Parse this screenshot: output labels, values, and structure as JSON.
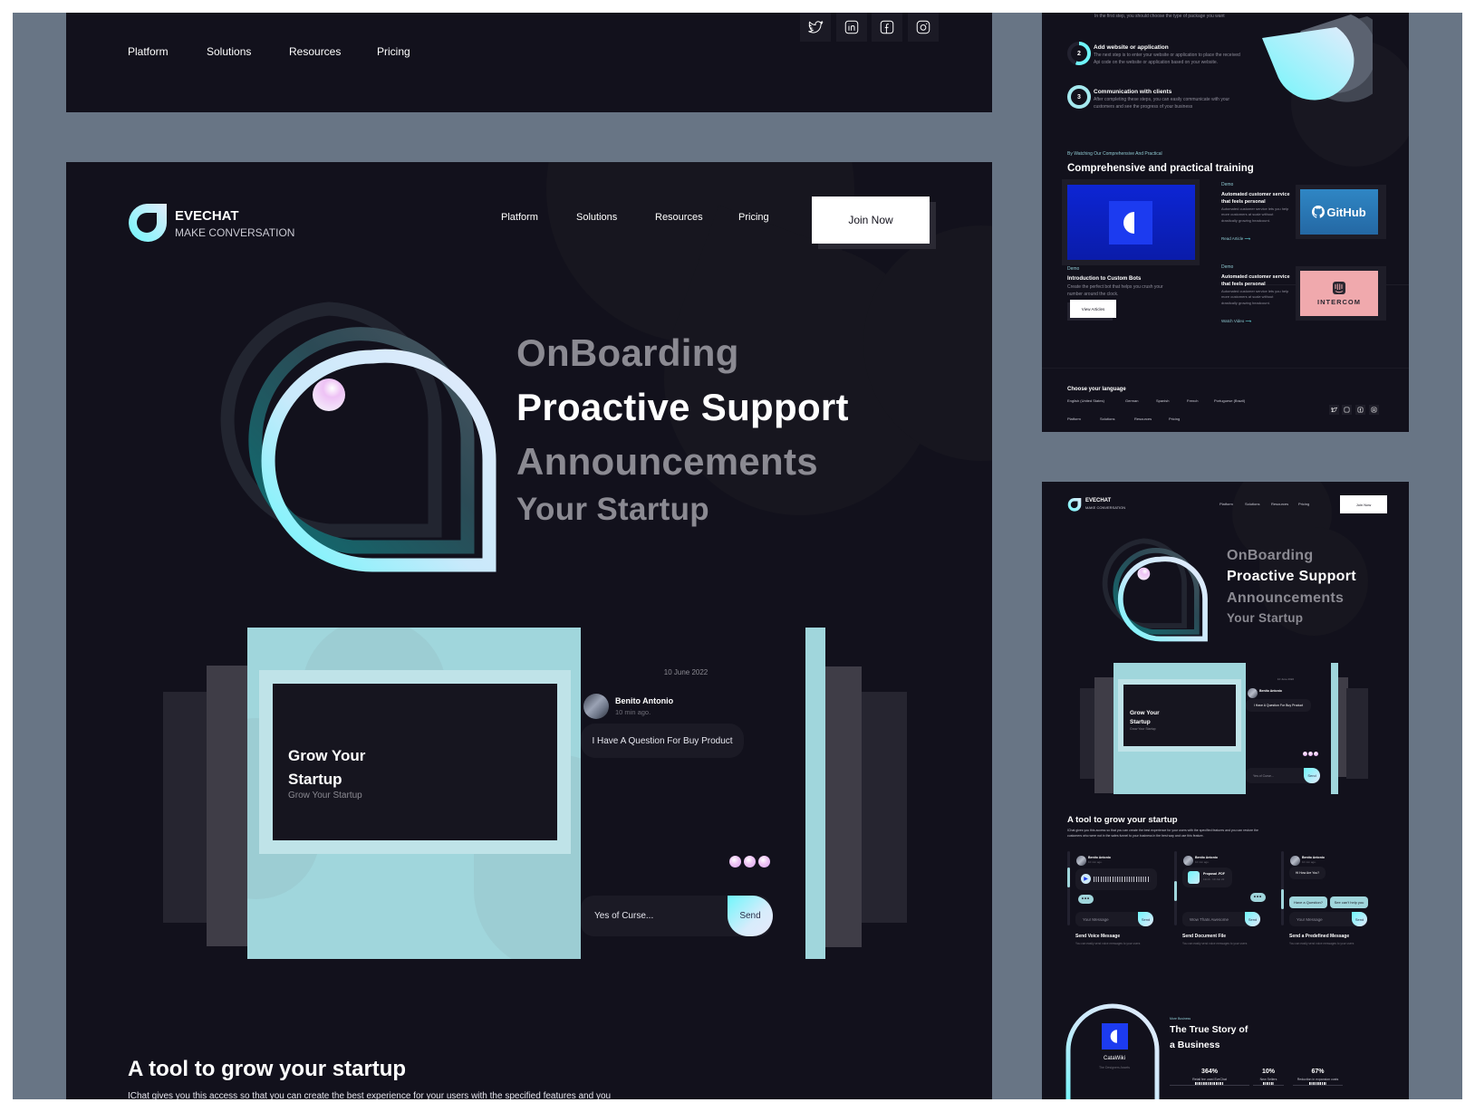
{
  "footer_top": {
    "nav": [
      "Platform",
      "Solutions",
      "Resources",
      "Pricing"
    ],
    "social": [
      "twitter-icon",
      "linkedin-icon",
      "facebook-icon",
      "instagram-icon"
    ]
  },
  "header": {
    "brand": "EVECHAT",
    "tagline": "MAKE CONVERSATION",
    "nav": [
      "Platform",
      "Solutions",
      "Resources",
      "Pricing"
    ],
    "cta": "Join Now"
  },
  "hero": {
    "lines": [
      "OnBoarding",
      "Proactive Support",
      "Announcements",
      "Your Startup"
    ],
    "active_index": 1
  },
  "showcase": {
    "card_title_1": "Grow Your",
    "card_title_2": "Startup",
    "card_subtitle": "Grow Your Startup",
    "chat": {
      "date": "10 June 2022",
      "user_name": "Benito Antonio",
      "time_ago": "10 min ago.",
      "message": "I Have A Question For Buy Product",
      "input_value": "Yes of Curse...",
      "send_label": "Send"
    }
  },
  "tool_section": {
    "title": "A tool to grow your startup",
    "description": "IChat gives you this access so that you can create the best experience for your users with the specified features and you",
    "description_full": "IChat gives you this access so that you can create the best experience for your users with the specified features and you can restore the customers who were not in the sales funnel to your business in the best way and use this feature."
  },
  "steps_panel": {
    "step1_desc": "In the first step, you should choose the type of package you want",
    "steps": [
      {
        "number": "2",
        "title": "Add website or application",
        "desc": "The next step is to enter your website or application to place the received Api code on the website or application based on your website."
      },
      {
        "number": "3",
        "title": "Communication with clients",
        "desc": "After completing these steps, you can easily communicate with your customers and see the progress of your business"
      }
    ],
    "training_kicker": "By Watching Our Comprehensive And Practical",
    "training_title": "Comprehensive and practical training",
    "featured": {
      "label": "Demo",
      "title": "Introduction to Custom Bots",
      "desc": "Create the perfect bot that helps you crush your number around the clock.",
      "button": "View Articles"
    },
    "articles": [
      {
        "label": "Demo",
        "title": "Automated customer service that feels personal",
        "desc": "Automated customer service lets you help more customers at scale without drastically growing headcount.",
        "link": "Read Article",
        "brand": "GitHub",
        "brand_color": "#2f86c4"
      },
      {
        "label": "Demo",
        "title": "Automated customer service that feels personal",
        "desc": "Automated customer service lets you help more customers at scale without drastically growing headcount.",
        "link": "Watch Video",
        "brand": "INTERCOM",
        "brand_color": "#f0a9ad"
      }
    ],
    "language_title": "Choose your language",
    "languages": [
      "English (United States)",
      "German",
      "Spanish",
      "French",
      "Portuguese (Brazil)"
    ],
    "footer_nav": [
      "Platform",
      "Solutions",
      "Resources",
      "Pricing"
    ]
  },
  "mobile_preview": {
    "brand": "EVECHAT",
    "tagline": "MAKE CONVERSATION",
    "nav": [
      "Platform",
      "Solutions",
      "Resources",
      "Pricing"
    ],
    "cta": "Join Now",
    "hero_lines": [
      "OnBoarding",
      "Proactive Support",
      "Announcements",
      "Your Startup"
    ],
    "card_title_1": "Grow Your",
    "card_title_2": "Startup",
    "card_subtitle": "Grow Your Startup",
    "chat_date": "10 June 2022",
    "chat_user": "Benito Antonio",
    "chat_message": "I Have A Question For Buy Product",
    "chat_input": "Yes of Curse...",
    "send": "Send",
    "tool_title": "A tool to grow your startup",
    "features": [
      {
        "user": "Benito Antonio",
        "time": "10 min ago.",
        "input": "Your Message",
        "title": "Send Voice Message",
        "desc": "You can easily send voice messages to your users",
        "progress": 0.3
      },
      {
        "user": "Benito Antonio",
        "time": "10 min ago.",
        "file_name": "Proposal .PDF",
        "file_meta": "12mb · 10 Jun 22",
        "input": "Wow Thats Awesome",
        "title": "Send Document File",
        "desc": "You can easily send voice messages to your users",
        "progress": 0.55
      },
      {
        "user": "Benito Antonio",
        "time": "10 min ago.",
        "message": "Hi How Are You?",
        "chips": [
          "Have a Question?",
          "See can't help you"
        ],
        "input": "Your Message",
        "title": "Send a Predefined Message",
        "desc": "You can easily send voice messages to your users",
        "progress": 0.7
      }
    ],
    "story": {
      "company": "CataWiki",
      "company_sub": "The Designers Assets",
      "kicker": "More Business",
      "title_1": "The True Story of",
      "title_2": "a Business",
      "stats": [
        {
          "value": "364%",
          "label": "Retail fee used EveChat"
        },
        {
          "value": "10%",
          "label": "New Sellers"
        },
        {
          "value": "67%",
          "label": "Reduction in expansion costs"
        }
      ]
    }
  },
  "colors": {
    "background": "#687585",
    "panel": "#12111c",
    "accent_teal": "#a0d6dc",
    "accent_cyan": "#6ff6fb",
    "accent_pink": "#e7b5f2",
    "catawiki_blue": "#1c3bf0"
  }
}
